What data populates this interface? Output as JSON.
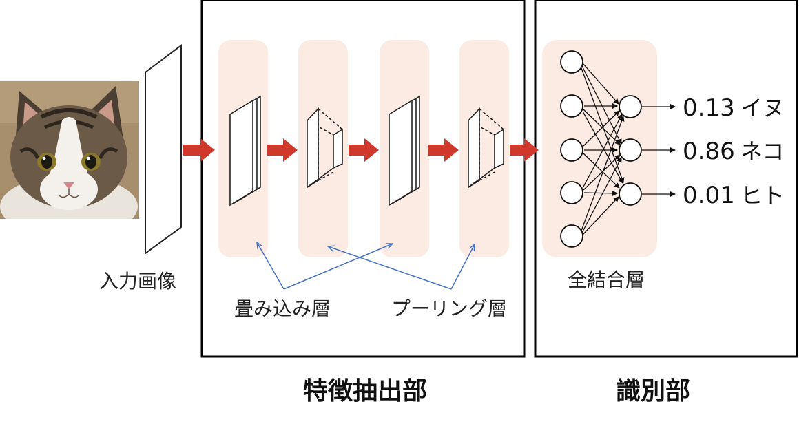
{
  "labels": {
    "input_image": "入力画像",
    "conv_layer": "畳み込み層",
    "pooling_layer": "プーリング層",
    "fc_layer": "全結合層",
    "feature_extraction": "特徴抽出部",
    "classification": "識別部"
  },
  "outputs": [
    {
      "score": "0.13",
      "label": "イヌ"
    },
    {
      "score": "0.86",
      "label": "ネコ"
    },
    {
      "score": "0.01",
      "label": "ヒト"
    }
  ],
  "colors": {
    "arrow_red": "#d0382b",
    "panel_pink": "#fcebe3",
    "pointer_blue": "#4472c4"
  },
  "icons": {
    "input_image": "cat-photo"
  }
}
